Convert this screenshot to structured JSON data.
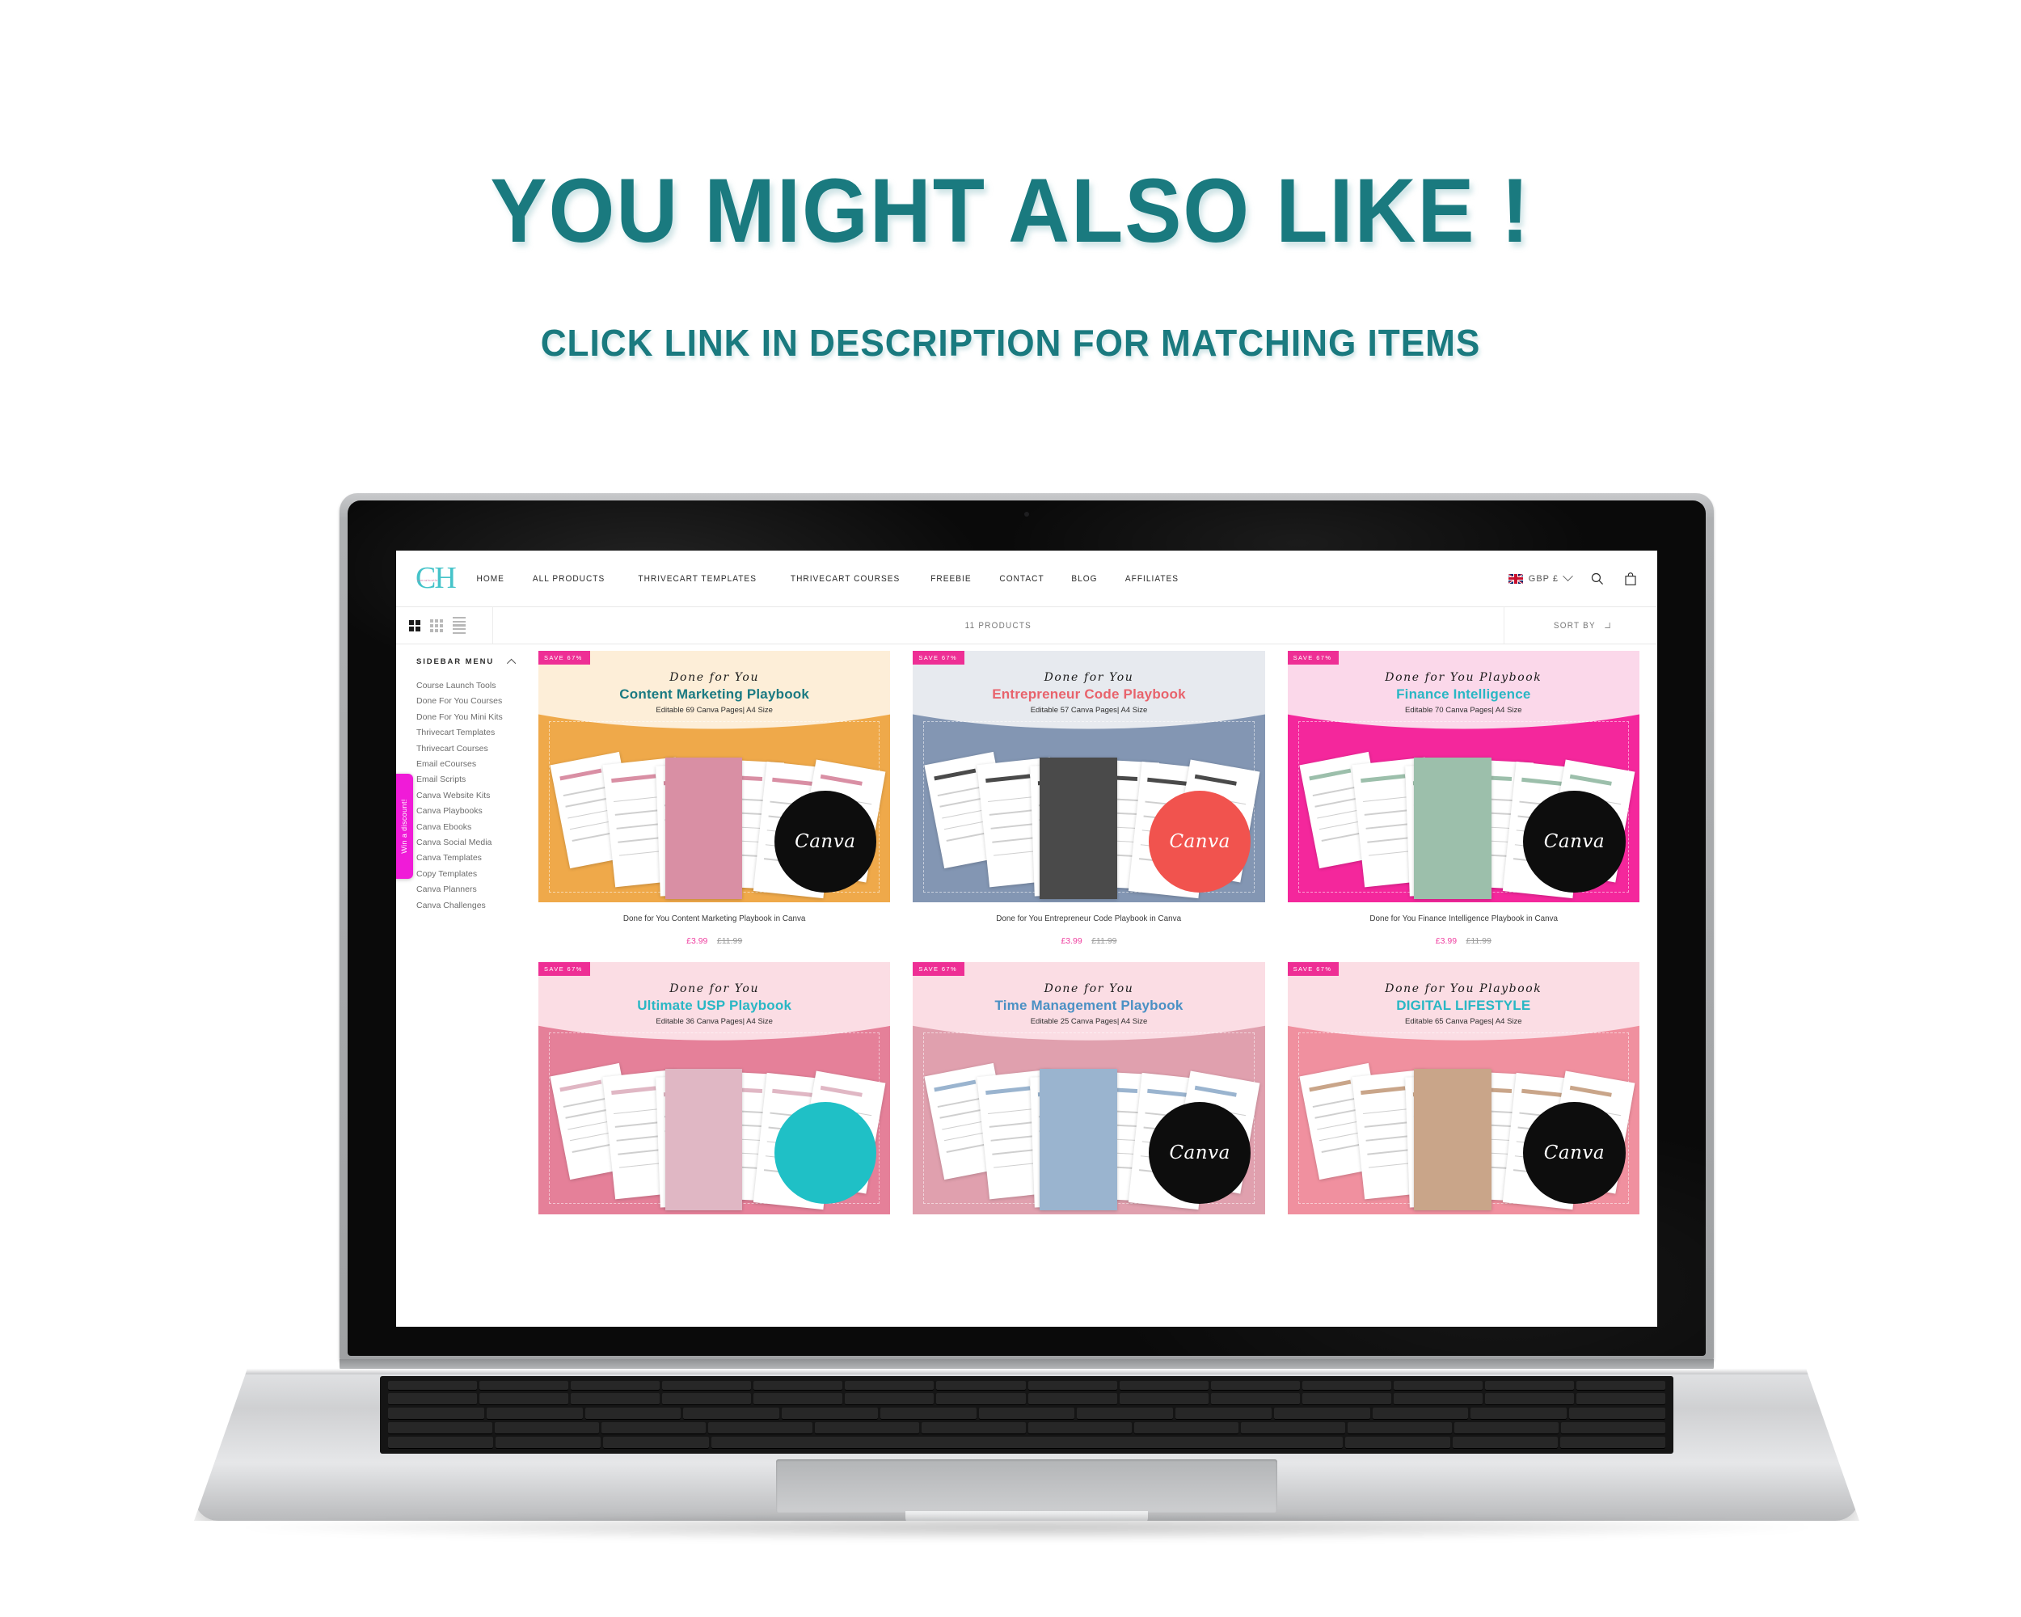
{
  "promo": {
    "title": "YOU MIGHT ALSO LIKE !",
    "subtitle": "CLICK LINK IN DESCRIPTION FOR MATCHING ITEMS",
    "accent_color": "#1a7a7f"
  },
  "header": {
    "logo_text": "CH",
    "logo_tagline": "canvahustle",
    "nav": [
      {
        "label": "HOME"
      },
      {
        "label": "ALL PRODUCTS"
      },
      {
        "label": "THRIVECART TEMPLATES"
      },
      {
        "label": "THRIVECART COURSES"
      },
      {
        "label": "FREEBIE"
      },
      {
        "label": "CONTACT"
      },
      {
        "label": "BLOG"
      },
      {
        "label": "AFFILIATES"
      }
    ],
    "currency": "GBP £",
    "flag_icon": "uk-flag-icon",
    "search_icon": "search-icon",
    "cart_icon": "shopping-bag-icon"
  },
  "toolbar": {
    "views": [
      "grid-2-icon",
      "grid-3-icon",
      "list-view-icon"
    ],
    "active_view": "grid-2-icon",
    "product_count": "11 PRODUCTS",
    "sort_label": "SORT BY"
  },
  "sidebar": {
    "heading": "SIDEBAR MENU",
    "collapse_icon": "chevron-up-icon",
    "items": [
      {
        "label": "Course Launch Tools"
      },
      {
        "label": "Done For You Courses"
      },
      {
        "label": "Done For You Mini Kits"
      },
      {
        "label": "Thrivecart Templates"
      },
      {
        "label": "Thrivecart Courses"
      },
      {
        "label": "Email eCourses"
      },
      {
        "label": "Email Scripts"
      },
      {
        "label": "Canva Website Kits"
      },
      {
        "label": "Canva Playbooks"
      },
      {
        "label": "Canva Ebooks"
      },
      {
        "label": "Canva Social Media"
      },
      {
        "label": "Canva Templates"
      },
      {
        "label": "Copy Templates"
      },
      {
        "label": "Canva Planners"
      },
      {
        "label": "Canva Challenges"
      }
    ]
  },
  "promo_tab": {
    "label": "Win a discount!",
    "color": "#f01bd8"
  },
  "products": [
    {
      "badge": "SAVE 67%",
      "script": "Done for You",
      "title": "Content Marketing Playbook",
      "title_color": "#1a7a82",
      "meta": "Editable 69 Canva Pages| A4 Size",
      "name": "Done for You Content Marketing Playbook in Canva",
      "price": "£3.99",
      "compare_at": "£11.99",
      "bg_top": "#fdeed8",
      "bg_bottom": "#efa94a",
      "canva_color": "#0d0d0d",
      "canva_label": "Canva",
      "sheet_accent": "#d98fa4"
    },
    {
      "badge": "SAVE 67%",
      "script": "Done for You",
      "title": "Entrepreneur Code Playbook",
      "title_color": "#e8636c",
      "meta": "Editable 57 Canva Pages| A4 Size",
      "name": "Done for You Entrepreneur Code Playbook in Canva",
      "price": "£3.99",
      "compare_at": "£11.99",
      "bg_top": "#e7eaef",
      "bg_bottom": "#8396b3",
      "canva_color": "#f1534e",
      "canva_label": "Canva",
      "sheet_accent": "#4a4a4a"
    },
    {
      "badge": "SAVE 67%",
      "script": "Done for You Playbook",
      "title": "Finance Intelligence",
      "title_color": "#29b7c4",
      "meta": "Editable 70 Canva Pages| A4 Size",
      "name": "Done for You Finance Intelligence Playbook in Canva",
      "price": "£3.99",
      "compare_at": "£11.99",
      "bg_top": "#fbd8ea",
      "bg_bottom": "#f4279c",
      "canva_color": "#0d0d0d",
      "canva_label": "Canva",
      "sheet_accent": "#9cbfab"
    },
    {
      "badge": "SAVE 67%",
      "script": "Done for You",
      "title": "Ultimate USP Playbook",
      "title_color": "#29b7c4",
      "meta": "Editable 36 Canva Pages| A4 Size",
      "name": "",
      "price": "",
      "compare_at": "",
      "bg_top": "#fbdde4",
      "bg_bottom": "#e58099",
      "canva_color": "#1fc0c6",
      "canva_label": "",
      "sheet_accent": "#e0b7c4"
    },
    {
      "badge": "SAVE 67%",
      "script": "Done for You",
      "title": "Time Management Playbook",
      "title_color": "#4a90c4",
      "meta": "Editable 25 Canva Pages| A4 Size",
      "name": "",
      "price": "",
      "compare_at": "",
      "bg_top": "#fbdde4",
      "bg_bottom": "#e0a0ae",
      "canva_color": "#0d0d0d",
      "canva_label": "Canva",
      "sheet_accent": "#9ab4cf"
    },
    {
      "badge": "SAVE 67%",
      "script": "Done for You Playbook",
      "title": "DIGITAL LIFESTYLE",
      "title_color": "#29b7c4",
      "meta": "Editable 65 Canva Pages| A4 Size",
      "name": "",
      "price": "",
      "compare_at": "",
      "bg_top": "#fbdde4",
      "bg_bottom": "#f0909f",
      "canva_color": "#0d0d0d",
      "canva_label": "Canva",
      "sheet_accent": "#c9a589"
    }
  ]
}
